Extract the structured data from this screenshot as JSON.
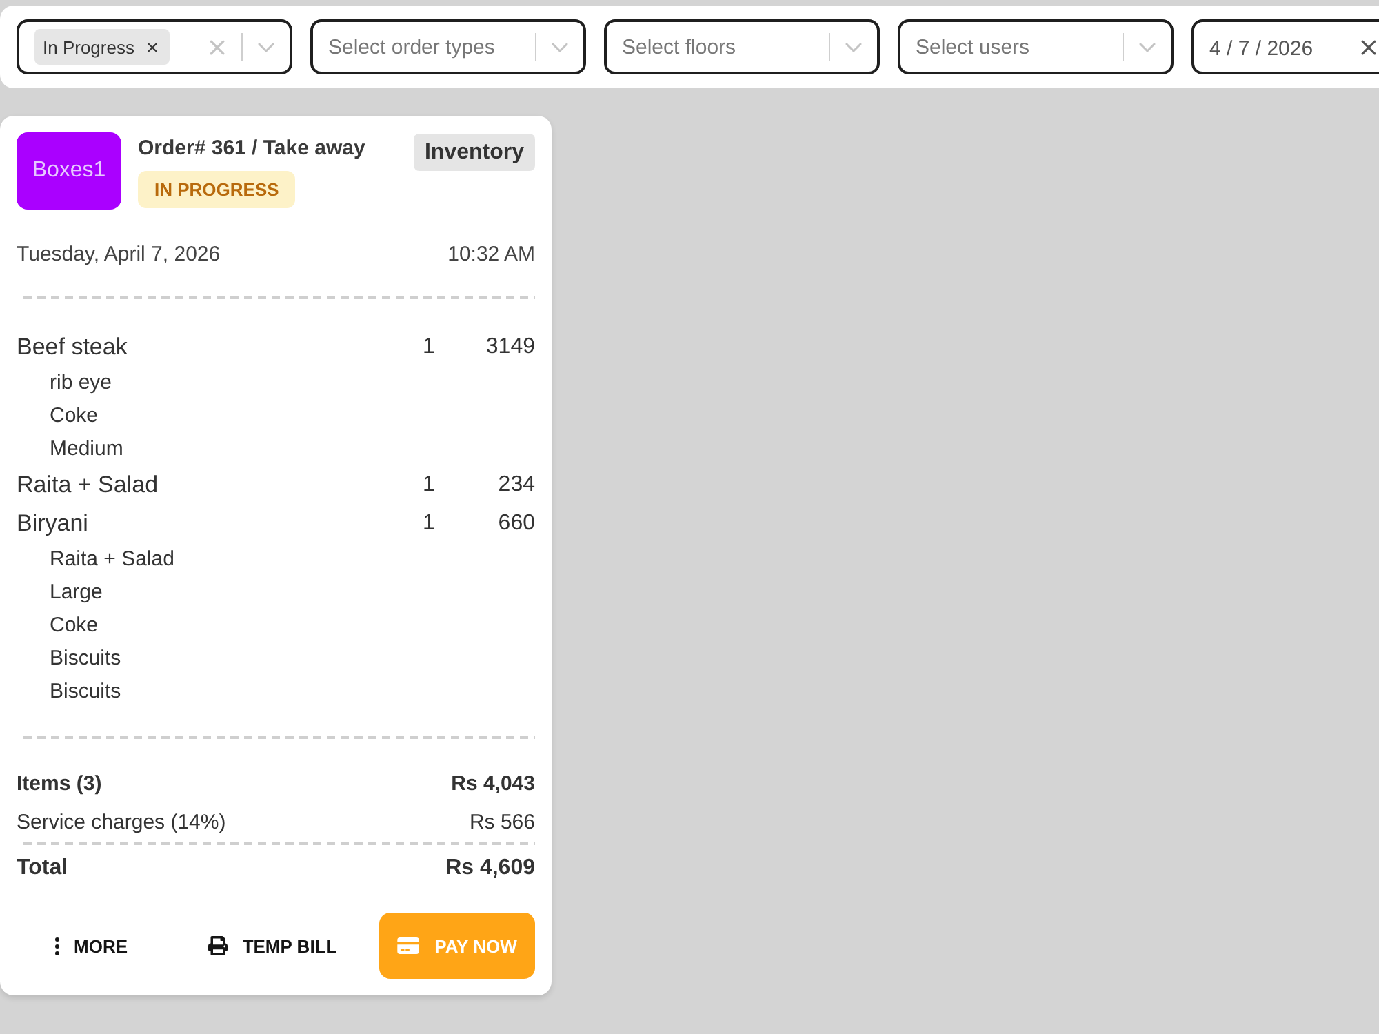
{
  "filters": [
    {
      "kind": "multi-select",
      "tags": [
        {
          "label": "In Progress"
        }
      ]
    },
    {
      "kind": "select",
      "placeholder": "Select order types"
    },
    {
      "kind": "select",
      "placeholder": "Select floors"
    },
    {
      "kind": "select",
      "placeholder": "Select users"
    },
    {
      "kind": "date",
      "value": "4 / 7 / 2026"
    }
  ],
  "order_card": {
    "tile": "Boxes1",
    "title": "Order# 361 / Take away",
    "status": {
      "label": "IN PROGRESS",
      "kind": "in-progress"
    },
    "tag": "Inventory",
    "date": "Tuesday, April 7, 2026",
    "time": "10:32 AM",
    "items": [
      {
        "name": "Beef steak",
        "quantity": "1",
        "price": "3149",
        "modifiers": [
          "rib eye",
          "Coke",
          "Medium"
        ]
      },
      {
        "name": "Raita + Salad",
        "quantity": "1",
        "price": "234"
      },
      {
        "name": "Biryani",
        "quantity": "1",
        "price": "660",
        "modifiers": [
          "Raita + Salad",
          "Large",
          "Coke",
          "Biscuits",
          "Biscuits"
        ]
      }
    ],
    "summary": [
      {
        "kind": "subtotal",
        "label": "Items (3)",
        "value": "Rs 4,043"
      },
      {
        "kind": "charge",
        "label": "Service charges (14%)",
        "value": "Rs 566"
      },
      {
        "kind": "total",
        "label": "Total",
        "value": "Rs 4,609"
      }
    ],
    "actions": [
      {
        "kind": "more",
        "label": "MORE"
      },
      {
        "kind": "print",
        "label": "TEMP BILL"
      },
      {
        "kind": "pay",
        "label": "PAY NOW"
      }
    ]
  }
}
